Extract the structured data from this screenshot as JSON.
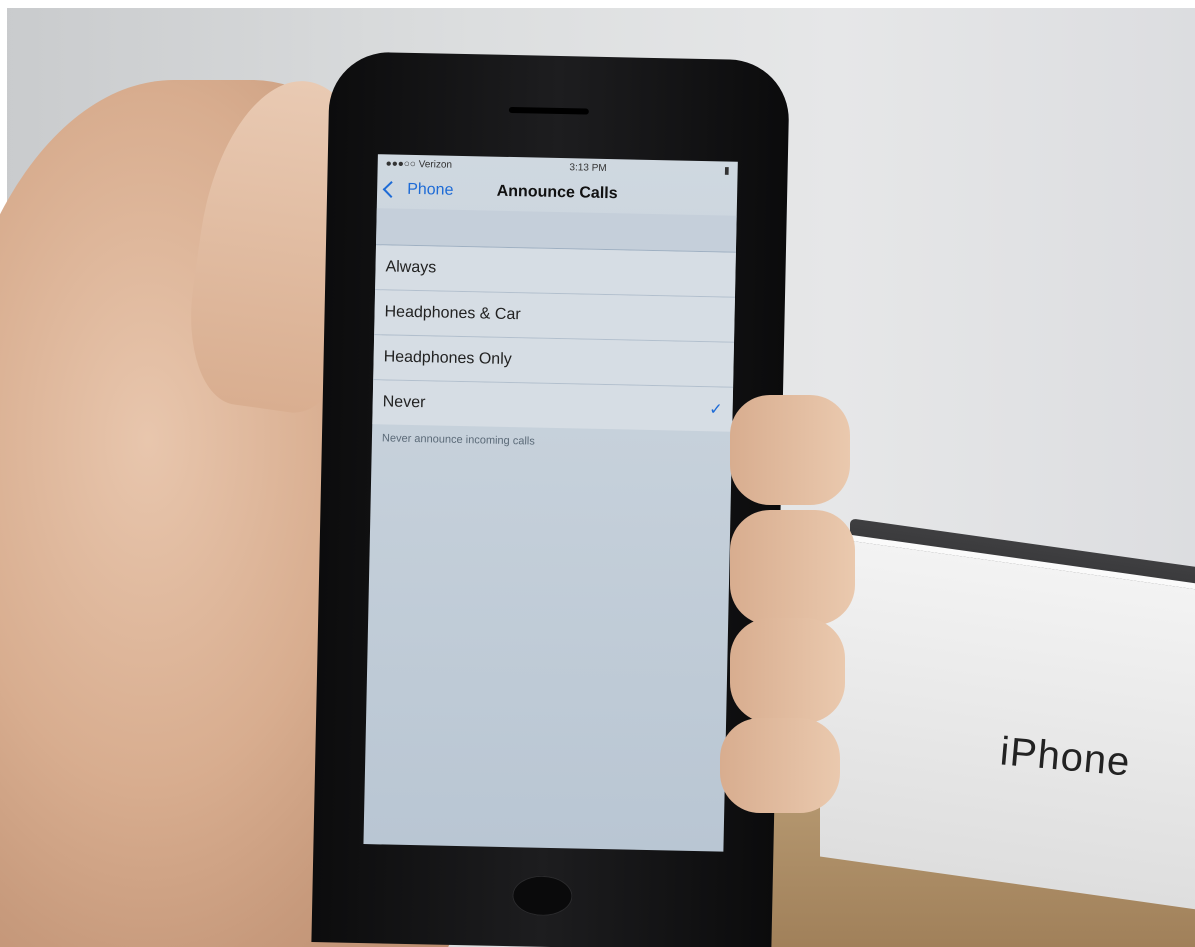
{
  "status": {
    "carrier": "●●●○○ Verizon",
    "time": "3:13 PM",
    "battery": "▮"
  },
  "nav": {
    "back_label": "Phone",
    "title": "Announce Calls"
  },
  "options": [
    {
      "label": "Always",
      "selected": false
    },
    {
      "label": "Headphones & Car",
      "selected": false
    },
    {
      "label": "Headphones Only",
      "selected": false
    },
    {
      "label": "Never",
      "selected": true
    }
  ],
  "footer_text": "Never announce incoming calls",
  "box_label": "iPhone"
}
